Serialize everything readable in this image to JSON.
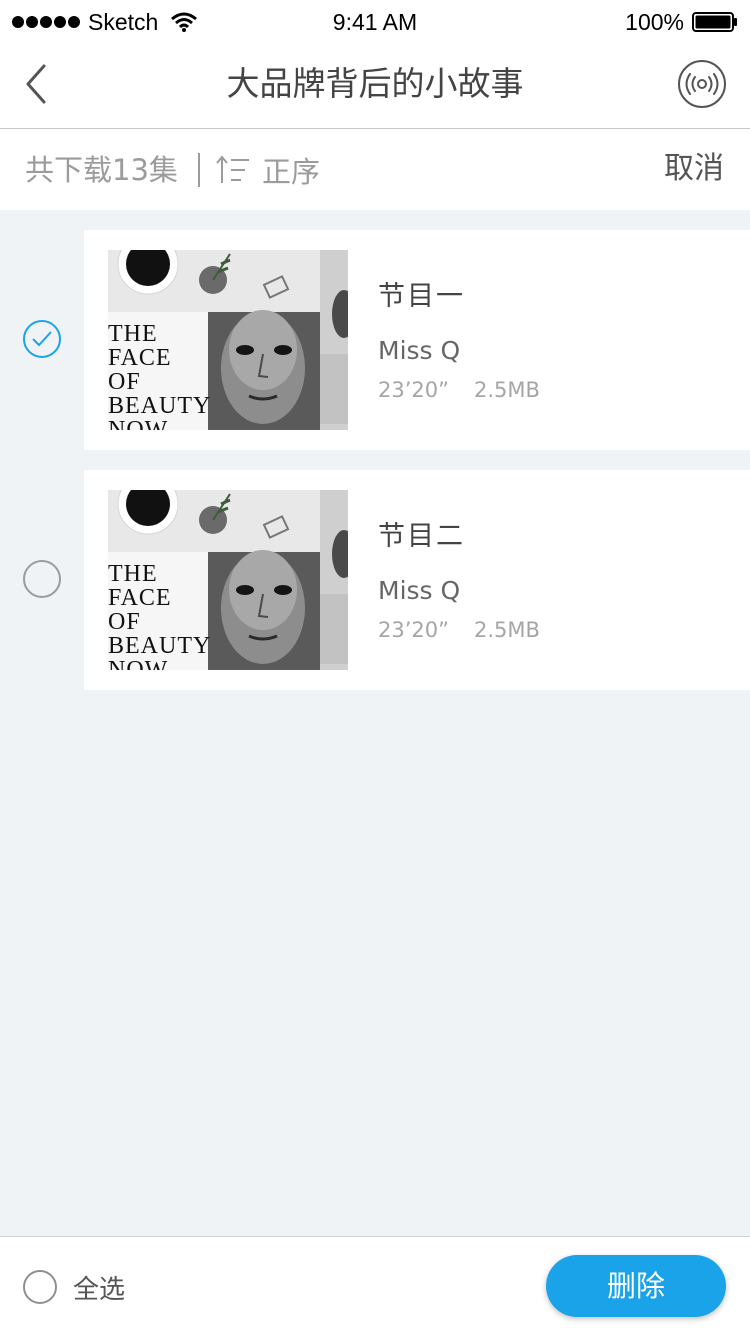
{
  "status_bar": {
    "carrier": "Sketch",
    "time": "9:41 AM",
    "battery": "100%"
  },
  "nav": {
    "title": "大品牌背后的小故事"
  },
  "toolbar": {
    "download_count": "共下载13集",
    "sort_label": "正序",
    "cancel_label": "取消"
  },
  "episodes": [
    {
      "title": "节目一",
      "author": "Miss Q",
      "duration": "23’20”",
      "size": "2.5MB",
      "selected": true
    },
    {
      "title": "节目二",
      "author": "Miss Q",
      "duration": "23’20”",
      "size": "2.5MB",
      "selected": false
    }
  ],
  "thumbnail": {
    "magazine_text": [
      "THE",
      "FACE",
      "OF",
      "BEAUTY",
      "NOW"
    ]
  },
  "bottom_bar": {
    "select_all_label": "全选",
    "delete_label": "删除"
  },
  "colors": {
    "accent": "#1aa3e8",
    "background": "#f0f3f5"
  },
  "icons": [
    "back-chevron-icon",
    "radio-broadcast-icon",
    "sort-ascending-icon",
    "check-icon",
    "wifi-icon",
    "battery-icon"
  ]
}
